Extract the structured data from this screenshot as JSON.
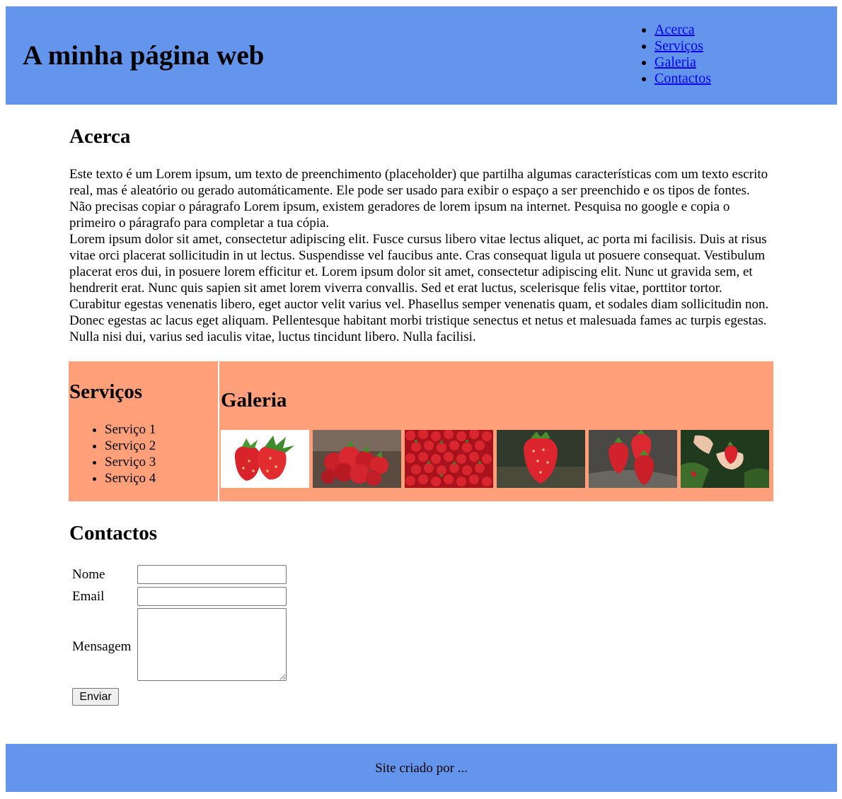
{
  "header": {
    "title": "A minha página web",
    "nav": [
      {
        "label": "Acerca"
      },
      {
        "label": "Serviços"
      },
      {
        "label": "Galeria"
      },
      {
        "label": "Contactos"
      }
    ],
    "background": "#6495ed"
  },
  "acerca": {
    "title": "Acerca",
    "paragraph1": "Este texto é um Lorem ipsum, um texto de preenchimento (placeholder) que partilha algumas características com um texto escrito real, mas é aleatório ou gerado automáticamente. Ele pode ser usado para exibir o espaço a ser preenchido e os tipos de fontes. Não precisas copiar o páragrafo Lorem ipsum, existem geradores de lorem ipsum na internet. Pesquisa no google e copia o primeiro o páragrafo para completar a tua cópia.",
    "paragraph2": "Lorem ipsum dolor sit amet, consectetur adipiscing elit. Fusce cursus libero vitae lectus aliquet, ac porta mi facilisis. Duis at risus vitae orci placerat sollicitudin in ut lectus. Suspendisse vel faucibus ante. Cras consequat ligula ut posuere consequat. Vestibulum placerat eros dui, in posuere lorem efficitur et. Lorem ipsum dolor sit amet, consectetur adipiscing elit. Nunc ut gravida sem, et hendrerit erat. Nunc quis sapien sit amet lorem viverra convallis. Sed et erat luctus, scelerisque felis vitae, porttitor tortor. Curabitur egestas venenatis libero, eget auctor velit varius vel. Phasellus semper venenatis quam, et sodales diam sollicitudin non. Donec egestas ac lacus eget aliquam. Pellentesque habitant morbi tristique senectus et netus et malesuada fames ac turpis egestas. Nulla nisi dui, varius sed iaculis vitae, luctus tincidunt libero. Nulla facilisi."
  },
  "servicos": {
    "title": "Serviços",
    "items": [
      {
        "label": "Serviço 1"
      },
      {
        "label": "Serviço 2"
      },
      {
        "label": "Serviço 3"
      },
      {
        "label": "Serviço 4"
      }
    ],
    "background": "#ffa07a"
  },
  "galeria": {
    "title": "Galeria",
    "images": [
      {
        "icon": "strawberry-pair-white-bg-image"
      },
      {
        "icon": "strawberry-pile-image"
      },
      {
        "icon": "strawberry-field-image"
      },
      {
        "icon": "single-strawberry-image"
      },
      {
        "icon": "strawberry-trio-image"
      },
      {
        "icon": "strawberry-in-hand-image"
      }
    ]
  },
  "contactos": {
    "title": "Contactos",
    "nome_label": "Nome",
    "nome_value": "",
    "email_label": "Email",
    "email_value": "",
    "mensagem_label": "Mensagem",
    "mensagem_value": "",
    "submit_label": "Enviar"
  },
  "footer": {
    "text": "Site criado por ...",
    "background": "#6495ed"
  }
}
